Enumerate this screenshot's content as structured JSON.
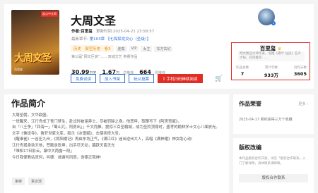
{
  "book": {
    "cover_tag": "起点中文网",
    "cover_title": "大周文圣",
    "cover_author": "百里玺",
    "title": "大周文圣",
    "author_label": "作者:",
    "author": "百里玺",
    "update_label": "更新时间:",
    "update_time": "2025-04-21 23:58:57",
    "latest_label": "最新章节:",
    "latest_chapter": "第103章 【七探探龙交心（圣级）】",
    "tag_main": "历史 · 架空历史 · 卷3",
    "tags": [
      "连载",
      "VIP",
      "女主",
      "东方玄幻"
    ],
    "sub_line": "第三届“网文巨浪”…… 双城文艺 参赛作品"
  },
  "stats": [
    {
      "num": "30.99",
      "unit": "万字",
      "label": ""
    },
    {
      "num": "1.67",
      "unit": "万",
      "label": "总推荐"
    },
    {
      "num": "664",
      "unit": "",
      "label": "周推荐"
    }
  ],
  "buttons": {
    "read": "免费试读",
    "shelf": "加入书架",
    "vote": "玩认投票",
    "mobile": "手机扫码继续阅读",
    "cart_icon": "cart-icon"
  },
  "author_card": {
    "name": "百里玺",
    "desc": "网文圈冠大神作家，笔推《夏叶 仙途》名声大振，获得推荐……",
    "stats": [
      {
        "label": "作品总数",
        "value": "7"
      },
      {
        "label": "累计字数",
        "value": "933万"
      },
      {
        "label": "创作天数",
        "value": "3605"
      }
    ]
  },
  "intro": {
    "heading": "作品简介",
    "paragraphs": [
      "大周圣朝，文华鼎盛。",
      "一觉醒来，江行舟成了青门孽生，赴试时被诬弄士，尽被罚除之身。他悲呼，取鞭写下《阿房宫赋》。",
      "自「八王争」「四海一」「蜀山兀，阿房出」」千文而推，震惊三百圣翰城，成为圣阶顶尊时，盛考的翰林学士文心八面放光。",
      "文字《佛说寺》，鲁轩世家文库，和示《冰雪赋》，击使状修大圣。",
      "《醒谁雀》一谷压九州，《将阳楼记》再启东坊正气，《满江红》迷出逆州大人，高唱《满神曜》神女助心动!",
      "江行舟孤身劲天地，苍脆逆乾坤，出手尽天动，踊跃天南天光",
      "「唯知17日影云，聚中大两露一段」",
      "今日我便教站流何，问德：诚谢何风雨，诛德正我神!"
    ],
    "chips": [
      "争锋",
      "意识流"
    ]
  },
  "honor": {
    "heading": "作品荣誉",
    "more": "更多 ›",
    "item": "2025-04-17  累积获得三万个收藏"
  },
  "copyright": {
    "heading": "版权改编",
    "desc": "本作品版权合作开放，详见「版权合作联系」入门了解详情，具体联系请邮联。",
    "button": "版权合作联系"
  },
  "colors": {
    "brand_red": "#e02d25",
    "link_blue": "#2f6fd8",
    "tag_orange": "#e28a00"
  }
}
